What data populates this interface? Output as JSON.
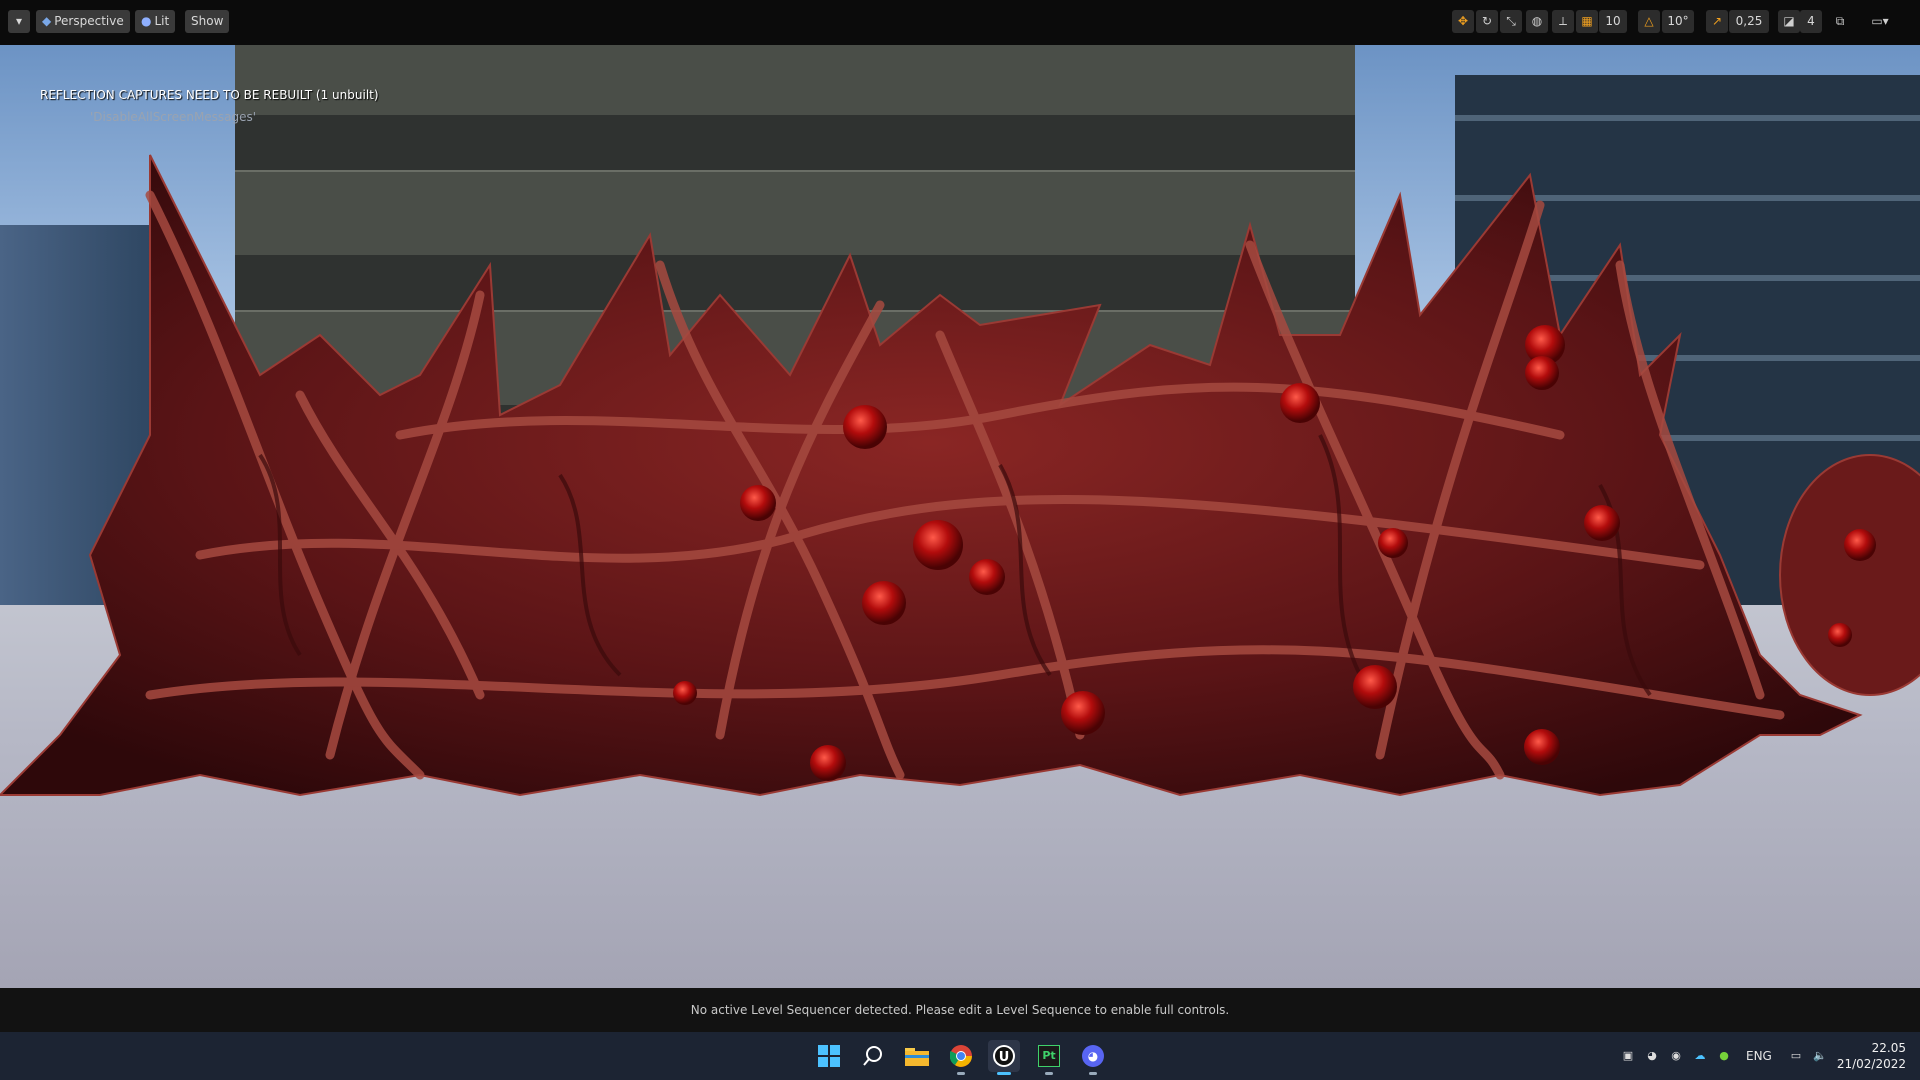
{
  "toolbar": {
    "perspective_label": "Perspective",
    "lit_label": "Lit",
    "show_label": "Show",
    "grid_snap_value": "10",
    "rotation_snap_value": "10°",
    "scale_snap_value": "0,25",
    "camera_speed_value": "4"
  },
  "viewport": {
    "warning": "REFLECTION CAPTURES NEED TO BE REBUILT (1 unbuilt)",
    "warning_sub": "'DisableAllScreenMessages'"
  },
  "sequencer": {
    "message": "No active Level Sequencer detected. Please edit a Level Sequence to enable full controls."
  },
  "taskbar": {
    "language": "ENG",
    "time": "22.05",
    "date": "21/02/2022",
    "pycharm_label": "Pt"
  },
  "colors": {
    "flesh": "#7a1e1c",
    "flesh_dark": "#3a0a0c",
    "eye": "#c01010",
    "accent_orange": "#f0a020"
  }
}
